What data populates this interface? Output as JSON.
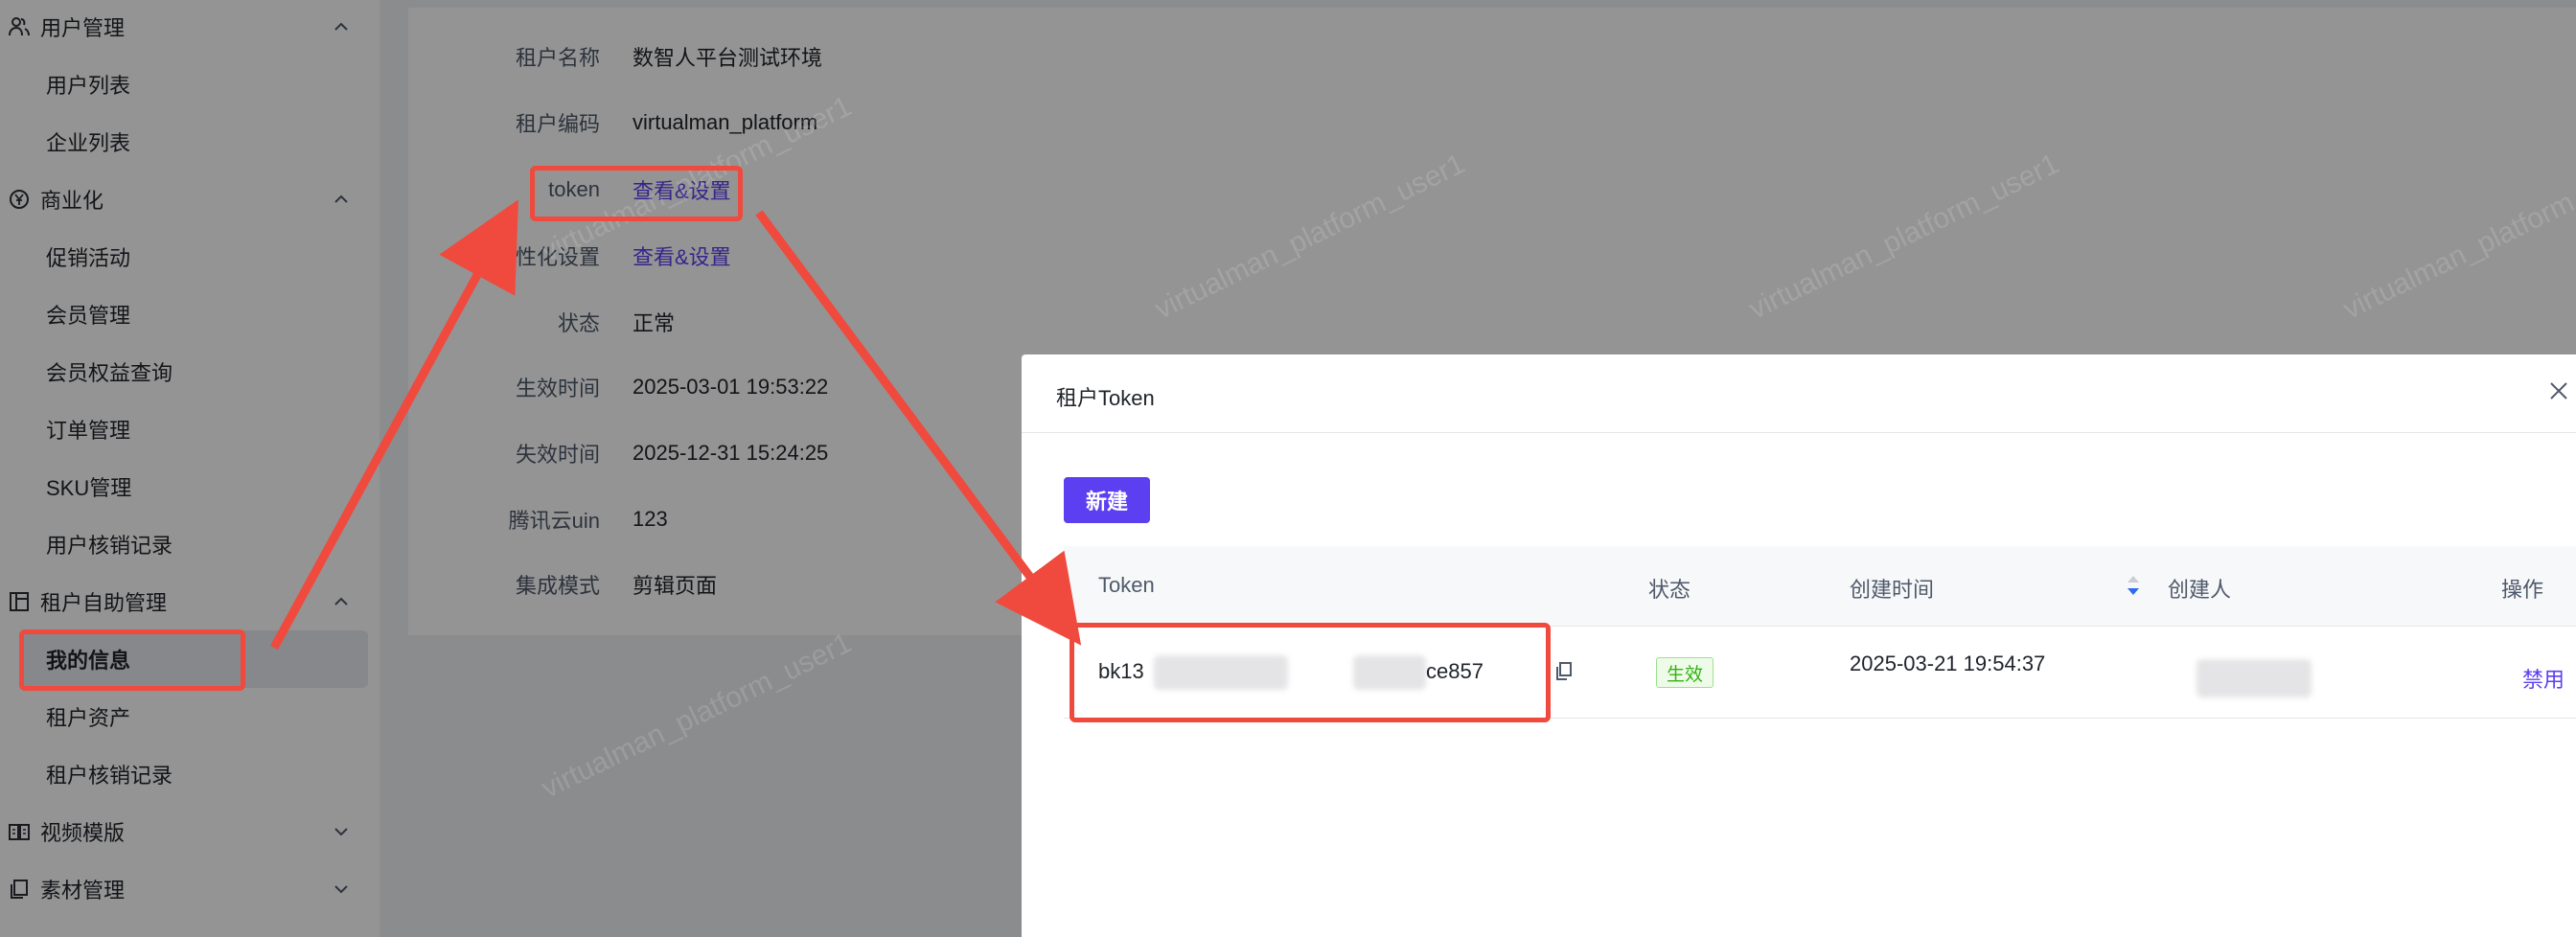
{
  "sidebar": {
    "groups": [
      {
        "label": "用户管理",
        "icon": "user-group-icon",
        "expanded": true
      },
      {
        "label": "商业化",
        "icon": "yen-icon",
        "expanded": true
      },
      {
        "label": "租户自助管理",
        "icon": "layout-icon",
        "expanded": true
      },
      {
        "label": "视频模版",
        "icon": "book-icon",
        "expanded": false
      },
      {
        "label": "素材管理",
        "icon": "copy-icon",
        "expanded": false
      }
    ],
    "items": {
      "user_list": "用户列表",
      "company_list": "企业列表",
      "promotion": "促销活动",
      "member_mgmt": "会员管理",
      "member_rights": "会员权益查询",
      "order_mgmt": "订单管理",
      "sku_mgmt": "SKU管理",
      "user_redeem": "用户核销记录",
      "my_info": "我的信息",
      "tenant_assets": "租户资产",
      "tenant_redeem": "租户核销记录"
    }
  },
  "info": {
    "rows": [
      {
        "label": "租户名称",
        "value": "数智人平台测试环境"
      },
      {
        "label": "租户编码",
        "value": "virtualman_platform"
      },
      {
        "label": "token",
        "value": "查看&设置"
      },
      {
        "label": "个性化设置",
        "value": "查看&设置"
      },
      {
        "label": "状态",
        "value": "正常"
      },
      {
        "label": "生效时间",
        "value": "2025-03-01 19:53:22"
      },
      {
        "label": "失效时间",
        "value": "2025-12-31 15:24:25"
      },
      {
        "label": "腾讯云uin",
        "value": "123"
      },
      {
        "label": "集成模式",
        "value": "剪辑页面"
      }
    ]
  },
  "watermark": "virtualman_platform_user1",
  "modal": {
    "title": "租户Token",
    "new_button": "新建",
    "columns": [
      "Token",
      "状态",
      "创建时间",
      "创建人",
      "操作"
    ],
    "row": {
      "token_prefix": "bk13",
      "token_suffix": "ce857",
      "status": "生效",
      "created_at": "2025-03-21 19:54:37",
      "action": "禁用"
    }
  },
  "colors": {
    "accent": "#5b3ff0",
    "annotation": "#ef4a3d",
    "status_green": "#32b212"
  }
}
